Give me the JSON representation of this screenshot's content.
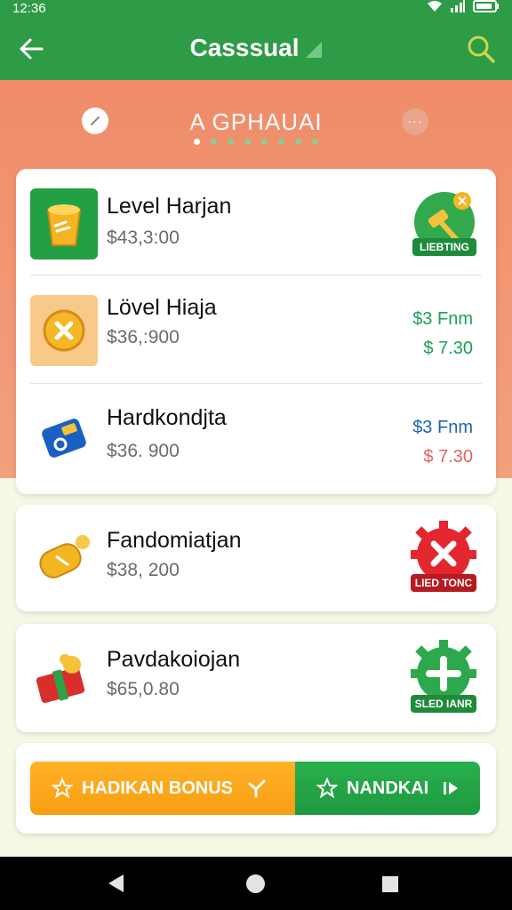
{
  "status": {
    "time": "12:36"
  },
  "app_bar": {
    "title": "Casssual"
  },
  "hero": {
    "title": "A GPHAUAI",
    "more": "···"
  },
  "items": [
    {
      "name": "Level Harjan",
      "price": "$43,3:00",
      "badge": "LIEBTING"
    },
    {
      "name": "Lövel Hiaja",
      "price": "$36,:900",
      "right_top": "$3 Fnm",
      "right_bottom": "$ 7.30"
    },
    {
      "name": "Hardkondjta",
      "price": "$36. 900",
      "right_top": "$3 Fnm",
      "right_bottom": "$ 7.30"
    },
    {
      "name": "Fandomiatjan",
      "price": "$38, 200",
      "badge": "LIED TONC"
    },
    {
      "name": "Pavdakoiojan",
      "price": "$65,0.80",
      "badge": "SLED IANR"
    }
  ],
  "buttons": {
    "bonus": "HADIKAN BONUS",
    "nandkai": "NANDKAI"
  },
  "colors": {
    "primary_green": "#2e9b46",
    "hero_orange": "#f08c6a",
    "bonus_orange": "#f89d12"
  }
}
